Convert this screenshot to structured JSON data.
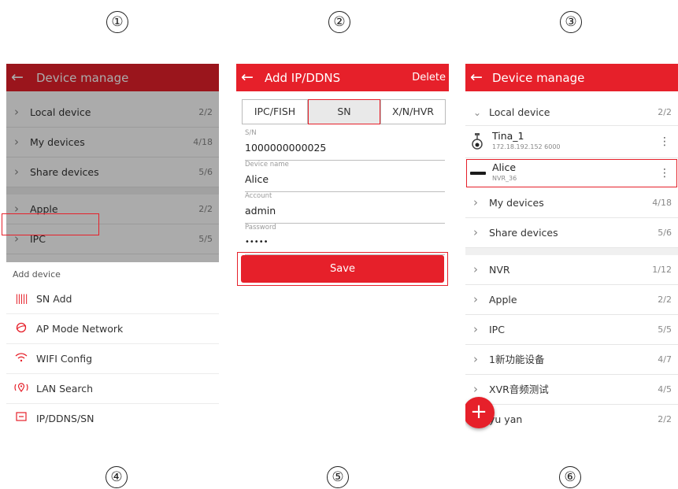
{
  "markers": [
    "①",
    "②",
    "③",
    "④",
    "⑤",
    "⑥"
  ],
  "colors": {
    "accent": "#e6202a",
    "divider": "#e6e6e6",
    "muted": "#888888"
  },
  "panel1": {
    "title": "Device manage",
    "groups": [
      {
        "label": "Local device",
        "count": "2/2"
      },
      {
        "label": "My devices",
        "count": "4/18"
      },
      {
        "label": "Share devices",
        "count": "5/6"
      },
      {
        "label": "Apple",
        "count": "2/2"
      },
      {
        "label": "IPC",
        "count": "5/5"
      }
    ],
    "sheet_title": "Add device",
    "sheet_items": [
      {
        "label": "SN Add",
        "icon": "barcode-icon"
      },
      {
        "label": "AP Mode Network",
        "icon": "globe-icon"
      },
      {
        "label": "WIFI Config",
        "icon": "wifi-icon"
      },
      {
        "label": "LAN Search",
        "icon": "location-icon"
      },
      {
        "label": "IP/DDNS/SN",
        "icon": "ip-icon"
      }
    ]
  },
  "panel2": {
    "title": "Add IP/DDNS",
    "delete_label": "Delete",
    "tabs": [
      "IPC/FISH",
      "SN",
      "X/N/HVR"
    ],
    "selected_tab": "SN",
    "fields": [
      {
        "label": "S/N",
        "value": "1000000000025"
      },
      {
        "label": "Device name",
        "value": "Alice"
      },
      {
        "label": "Account",
        "value": "admin"
      },
      {
        "label": "Password",
        "value": "•••••"
      }
    ],
    "save_label": "Save"
  },
  "panel3": {
    "title": "Device manage",
    "local": {
      "label": "Local device",
      "count": "2/2"
    },
    "devices": [
      {
        "name": "Tina_1",
        "sub": "172.18.192.152  6000",
        "icon": "camera-icon"
      },
      {
        "name": "Alice",
        "sub": "NVR_36",
        "icon": "nvr-icon"
      }
    ],
    "groups": [
      {
        "label": "My devices",
        "count": "4/18"
      },
      {
        "label": "Share devices",
        "count": "5/6"
      },
      {
        "label": "NVR",
        "count": "1/12"
      },
      {
        "label": "Apple",
        "count": "2/2"
      },
      {
        "label": "IPC",
        "count": "5/5"
      },
      {
        "label": "1新功能设备",
        "count": "4/7"
      },
      {
        "label": "XVR音频测试",
        "count": "4/5"
      },
      {
        "label": "yu yan",
        "count": "2/2"
      }
    ]
  }
}
